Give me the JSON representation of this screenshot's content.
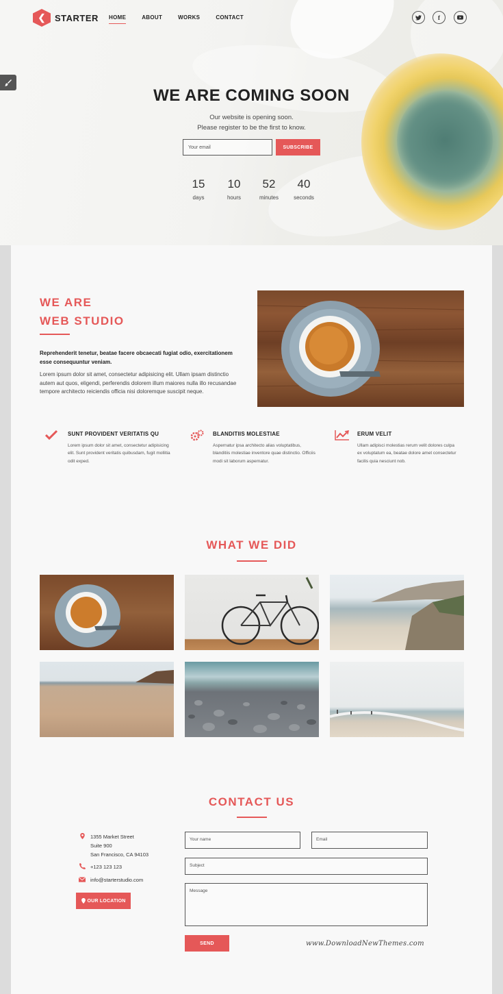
{
  "brand": {
    "name": "STARTER"
  },
  "nav": {
    "items": [
      "HOME",
      "ABOUT",
      "WORKS",
      "CONTACT"
    ],
    "active": "HOME"
  },
  "social": {
    "icons": [
      "twitter-icon",
      "facebook-icon",
      "youtube-icon"
    ]
  },
  "hero": {
    "title": "WE ARE COMING SOON",
    "line1": "Our website is opening soon.",
    "line2": "Please register to be the first to know.",
    "email_placeholder": "Your email",
    "subscribe_label": "SUBSCRIBE",
    "countdown": [
      {
        "value": "15",
        "label": "days"
      },
      {
        "value": "10",
        "label": "hours"
      },
      {
        "value": "52",
        "label": "minutes"
      },
      {
        "value": "40",
        "label": "seconds"
      }
    ]
  },
  "about": {
    "title_line1": "WE ARE",
    "title_line2": "WEB STUDIO",
    "lead": "Reprehenderit tenetur, beatae facere obcaecati fugiat odio, exercitationem esse consequuntur veniam.",
    "body": "Lorem ipsum dolor sit amet, consectetur adipisicing elit. Ullam ipsam distinctio autem aut quos, eligendi, perferendis dolorem illum maiores nulla illo recusandae tempore architecto reiciendis officia nisi doloremque suscipit neque."
  },
  "features": [
    {
      "icon": "check-icon",
      "title": "SUNT PROVIDENT VERITATIS QU",
      "text": "Lorem ipsum dolor sit amet, consectetur adipisicing elit. Sunt provident veritatis quibusdam, fugit mollitia odit exped."
    },
    {
      "icon": "gears-icon",
      "title": "BLANDITIIS MOLESTIAE",
      "text": "Aspernatur ipsa architecto alias voluptatibus, blanditiis molestiae inventore quae distinctio. Officiis modi sit laborum aspernatur."
    },
    {
      "icon": "chart-line-icon",
      "title": "ERUM VELIT",
      "text": "Ullam adipisci molestias rerum velit dolores culpa ex voluptatum ea, beatae dolore amet consectetur facilis quia nesciunt nob."
    }
  ],
  "works": {
    "title": "WHAT WE DID"
  },
  "contact": {
    "title": "CONTACT US",
    "address_line1": "1355 Market Street",
    "address_line2": "Suite 900",
    "address_line3": "San Francisco, CA 94103",
    "phone": "+123 123 123",
    "email": "info@starterstudio.com",
    "location_label": "OUR LOCATION",
    "name_placeholder": "Your name",
    "email_placeholder": "Email",
    "subject_placeholder": "Subject",
    "message_placeholder": "Message",
    "send_label": "SEND"
  },
  "watermark": "www.DownloadNewThemes.com",
  "colors": {
    "accent": "#e55858",
    "text": "#222222",
    "panel": "#f8f8f8"
  }
}
